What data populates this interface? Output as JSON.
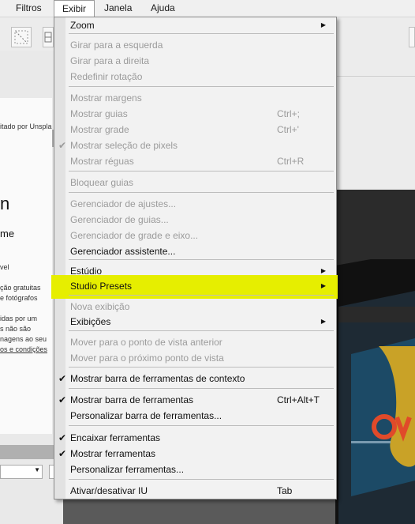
{
  "menubar": {
    "items": [
      "Filtros",
      "Exibir",
      "Janela",
      "Ajuda"
    ]
  },
  "left_panel": {
    "credit": "itado por Unspla",
    "heading_big": "n",
    "heading_small": "me",
    "lines": [
      "vel",
      "ção gratuitas",
      "e fotógrafos",
      "",
      "idas por um",
      "s não são",
      "nagens ao seu",
      "os e condições"
    ]
  },
  "menu": {
    "items": [
      {
        "label": "Zoom",
        "enabled": true,
        "submenu": true
      },
      {
        "label": "Girar para a esquerda",
        "enabled": false
      },
      {
        "label": "Girar para a direita",
        "enabled": false
      },
      {
        "label": "Redefinir rotação",
        "enabled": false
      },
      {
        "label": "Mostrar margens",
        "enabled": false
      },
      {
        "label": "Mostrar guias",
        "enabled": false,
        "shortcut": "Ctrl+;"
      },
      {
        "label": "Mostrar grade",
        "enabled": false,
        "shortcut": "Ctrl+'"
      },
      {
        "label": "Mostrar seleção de pixels",
        "enabled": false,
        "checked": true
      },
      {
        "label": "Mostrar réguas",
        "enabled": false,
        "shortcut": "Ctrl+R"
      },
      {
        "label": "Bloquear guias",
        "enabled": false
      },
      {
        "label": "Gerenciador de ajustes...",
        "enabled": false
      },
      {
        "label": "Gerenciador de guias...",
        "enabled": false
      },
      {
        "label": "Gerenciador de grade e eixo...",
        "enabled": false
      },
      {
        "label": "Gerenciador assistente...",
        "enabled": true
      },
      {
        "label": "Estúdio",
        "enabled": true,
        "submenu": true
      },
      {
        "label": "Studio Presets",
        "enabled": true,
        "submenu": true,
        "highlighted": true
      },
      {
        "label": "Nova exibição",
        "enabled": false
      },
      {
        "label": "Exibições",
        "enabled": true,
        "submenu": true
      },
      {
        "label": "Mover para o ponto de vista anterior",
        "enabled": false
      },
      {
        "label": "Mover para o próximo ponto de vista",
        "enabled": false
      },
      {
        "label": "Mostrar barra de ferramentas de contexto",
        "enabled": true,
        "checked": true
      },
      {
        "label": "Mostrar barra de ferramentas",
        "enabled": true,
        "checked": true,
        "shortcut": "Ctrl+Alt+T"
      },
      {
        "label": "Personalizar barra de ferramentas...",
        "enabled": true
      },
      {
        "label": "Encaixar ferramentas",
        "enabled": true,
        "checked": true
      },
      {
        "label": "Mostrar ferramentas",
        "enabled": true,
        "checked": true
      },
      {
        "label": "Personalizar ferramentas...",
        "enabled": true
      },
      {
        "label": "Ativar/desativar IU",
        "enabled": true,
        "shortcut": "Tab"
      }
    ]
  },
  "colors": {
    "highlight": "#e6ee00",
    "disabled_text": "#9b9b9b",
    "menu_bg": "#f2f2f2"
  },
  "icons": {
    "check": "checkmark-icon",
    "submenu": "submenu-arrow-icon",
    "dropdown": "chevron-down-icon"
  }
}
